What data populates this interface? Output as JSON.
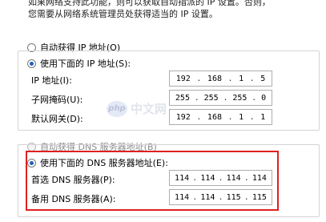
{
  "intro": {
    "line1": "如果网络支持此功能，则可以获取自动指派的 IP 设置。否则，",
    "line2": "您需要从网络系统管理员处获得适当的 IP 设置。"
  },
  "ip_section": {
    "auto_ip_label": "自动获得 IP 地址(O)",
    "manual_ip_label": "使用下面的 IP 地址(S):",
    "ip_label": "IP 地址(I):",
    "ip_value": [
      "192",
      "168",
      "1",
      "5"
    ],
    "mask_label": "子网掩码(U):",
    "mask_value": [
      "255",
      "255",
      "255",
      "0"
    ],
    "gateway_label": "默认网关(D):",
    "gateway_value": [
      "192",
      "168",
      "1",
      "1"
    ]
  },
  "dns_section": {
    "auto_dns_label": "自动获得 DNS 服务器地址(B)",
    "manual_dns_label": "使用下面的 DNS 服务器地址(E):",
    "preferred_label": "首选 DNS 服务器(P):",
    "preferred_value": [
      "114",
      "114",
      "114",
      "114"
    ],
    "alternate_label": "备用 DNS 服务器(A):",
    "alternate_value": [
      "114",
      "114",
      "115",
      "115"
    ]
  },
  "watermark": {
    "logo": "php",
    "text": "中文网"
  },
  "colors": {
    "highlight": "#e02020",
    "radio_dot": "#1f5fbf"
  }
}
